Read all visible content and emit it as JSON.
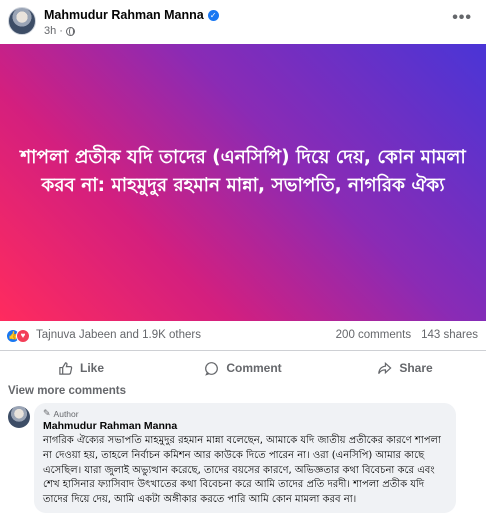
{
  "post": {
    "author": "Mahmudur Rahman Manna",
    "time": "3h",
    "more_icon": "more-horizontal-icon",
    "banner_text": "শাপলা প্রতীক যদি তাদের (এনসিপি) দিয়ে দেয়, কোন মামলা করব না: মাহমুদুর রহমান মান্না, সভাপতি, নাগরিক ঐক্য",
    "banner_colors": [
      "#ff2b5e",
      "#d41f7e",
      "#8a2bb5",
      "#4a35d6"
    ]
  },
  "stats": {
    "reactions": "Tajnuva Jabeen and 1.9K others",
    "comments": "200 comments",
    "shares": "143 shares"
  },
  "actions": {
    "like": "Like",
    "comment": "Comment",
    "share": "Share"
  },
  "comments": {
    "view_more": "View more comments",
    "items": [
      {
        "badge": "Author",
        "author": "Mahmudur Rahman Manna",
        "text": "নাগরিক ঐক্যের সভাপতি মাহমুদুর রহমান মান্না বলেছেন, আমাকে যদি জাতীয় প্রতীকের কারণে শাপলা না দেওয়া হয়, তাহলে নির্বাচন কমিশন আর কাউকে দিতে পারেন না। ওরা (এনসিপি) আমার কাছে এসেছিল। যারা জুলাই অভ্যুত্থান করেছে, তাদের বয়সের কারণে, অভিজ্ঞতার কথা বিবেচনা করে এবং শেখ হাসিনার ফ্যাসিবাদ উৎখাতের কথা বিবেচনা করে আমি তাদের প্রতি দরদী। শাপলা প্রতীক যদি তাদের দিয়ে দেয়, আমি একটা অঙ্গীকার করতে পারি আমি কোন মামলা করব না।"
      }
    ]
  },
  "colors": {
    "accent": "#1877f2",
    "love": "#f33e58",
    "muted_text": "#65676b",
    "comment_bg": "#f0f2f5"
  }
}
